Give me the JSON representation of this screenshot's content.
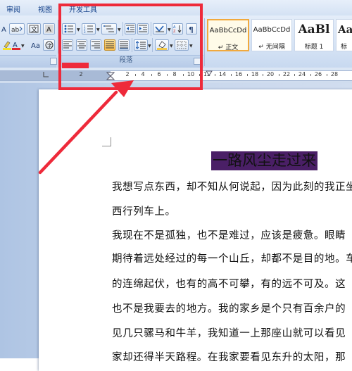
{
  "ribbon_tabs": {
    "review": "审阅",
    "view": "视图",
    "developer": "开发工具"
  },
  "paragraph_group": {
    "label": "段落"
  },
  "styles": [
    {
      "sample": "AaBbCcDd",
      "name": "↵ 正文",
      "selected": true
    },
    {
      "sample": "AaBbCcDd",
      "name": "↵ 无间隔",
      "selected": false
    },
    {
      "sample": "AaBl",
      "name": "标题 1",
      "selected": false
    },
    {
      "sample": "AaB",
      "name": "标",
      "selected": false
    }
  ],
  "ruler": {
    "labels": [
      "2",
      "2",
      "4",
      "6",
      "8",
      "10",
      "12",
      "14",
      "16",
      "18",
      "20",
      "22",
      "24",
      "26",
      "28"
    ]
  },
  "document": {
    "title": "一路风尘走过来",
    "lines": [
      "我想写点东西，却不知从何说起，因为此刻的我正坐",
      "西行列车上。",
      "我现在不是孤独，也不是难过，应该是疲惫。眼睛",
      "期待着远处经过的每一个山丘，却都不是目的地。车",
      "的连绵起伏，也有的高不可攀，有的远不可及。这",
      "也不是我要去的地方。我的家乡是个只有百余户的",
      "见几只骡马和牛羊，我知道一上那座山就可以看见",
      "家却还得半天路程。在我家要看见东升的太阳，那"
    ]
  },
  "colors": {
    "annotation": "#ee2a3a",
    "title_highlight": "#4a1f66",
    "style_selected_border": "#f1a93d"
  }
}
